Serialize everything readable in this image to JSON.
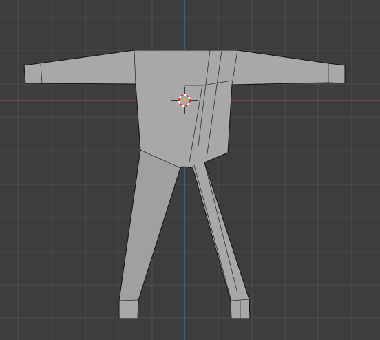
{
  "viewport": {
    "background_color": "#3d3d3d",
    "grid_minor_color": "#464646",
    "grid_major_color": "#4e4e4e",
    "x_axis_color": "#a6434a",
    "z_axis_color": "#4a76a8"
  },
  "model": {
    "face_color": "#a7a9a8",
    "face_shade_color": "#9fa1a0",
    "edge_color": "#2b2b2b",
    "selection_outline_color": "#111111"
  },
  "cursor_3d": {
    "icon": "3d-cursor-icon",
    "ring_red": "#d6232b",
    "ring_white": "#ffffff",
    "center_color": "#f0a23a"
  }
}
